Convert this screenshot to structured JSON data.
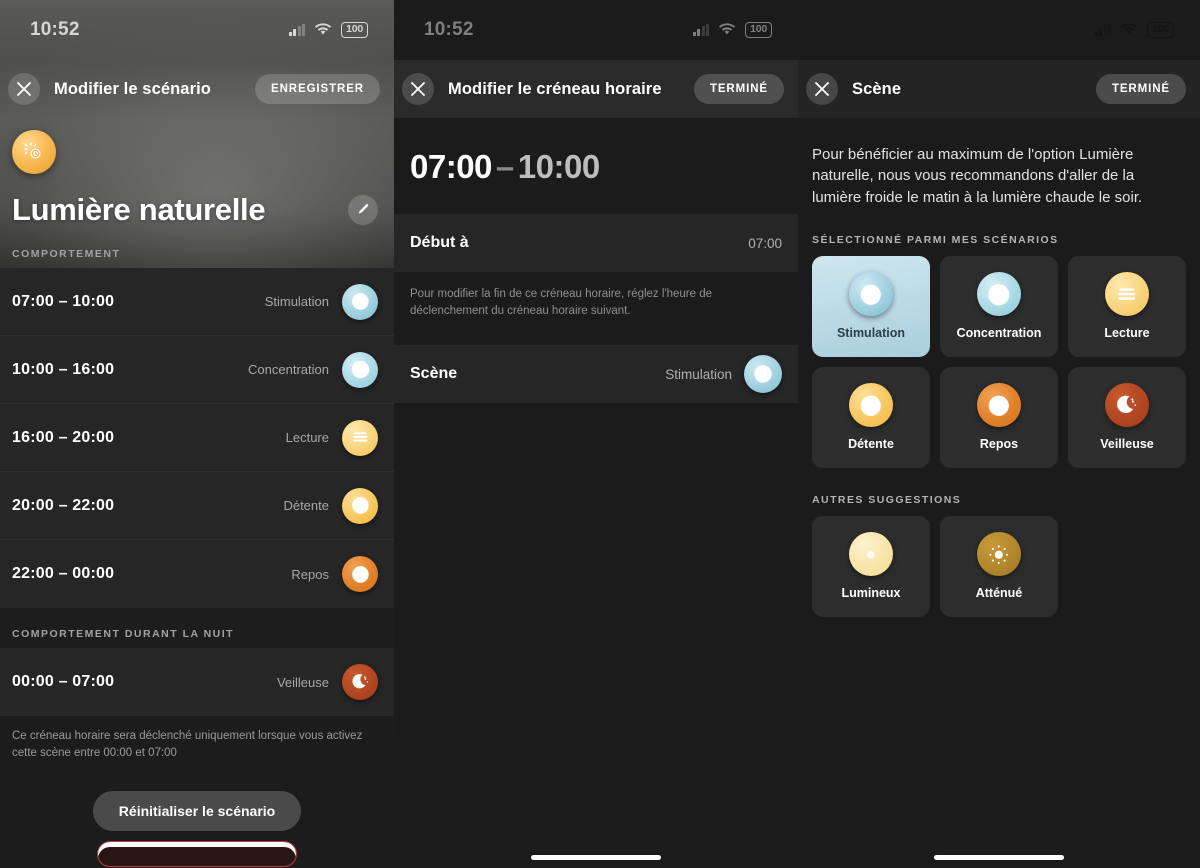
{
  "panel1": {
    "status": {
      "time": "10:52",
      "battery": "100",
      "icons": [
        "cellular-signal-icon",
        "wifi-icon",
        "battery-icon"
      ]
    },
    "nav": {
      "close_icon": "close-icon",
      "title": "Modifier le scénario",
      "action": "ENREGISTRER"
    },
    "hero": {
      "avatar_icon": "natural-light-icon",
      "title": "Lumière naturelle",
      "edit_icon": "pencil-icon"
    },
    "behavior_label": "COMPORTEMENT",
    "slots": [
      {
        "time": "07:00 – 10:00",
        "scene": "Stimulation",
        "icon": "stimulation-icon"
      },
      {
        "time": "10:00 – 16:00",
        "scene": "Concentration",
        "icon": "concentration-icon"
      },
      {
        "time": "16:00 – 20:00",
        "scene": "Lecture",
        "icon": "lecture-icon"
      },
      {
        "time": "20:00 – 22:00",
        "scene": "Détente",
        "icon": "detente-icon"
      },
      {
        "time": "22:00 – 00:00",
        "scene": "Repos",
        "icon": "repos-icon"
      }
    ],
    "night_label": "COMPORTEMENT DURANT LA NUIT",
    "night_slot": {
      "time": "00:00 – 07:00",
      "scene": "Veilleuse",
      "icon": "veilleuse-icon"
    },
    "footnote": "Ce créneau horaire sera déclenché uniquement lorsque vous activez cette scène entre 00:00 et 07:00",
    "reset_button": "Réinitialiser le scénario",
    "delete_button": ""
  },
  "panel2": {
    "status": {
      "time": "10:52",
      "battery": "100"
    },
    "nav": {
      "close_icon": "close-icon",
      "title": "Modifier le créneau horaire",
      "action": "TERMINÉ"
    },
    "range": {
      "start": "07:00",
      "dash": "–",
      "end": "10:00"
    },
    "start_row": {
      "label": "Début à",
      "value": "07:00"
    },
    "help": "Pour modifier la fin de ce créneau horaire, réglez l'heure de déclenchement du créneau horaire suivant.",
    "scene_row": {
      "label": "Scène",
      "value": "Stimulation",
      "icon": "stimulation-icon"
    }
  },
  "panel3": {
    "nav": {
      "close_icon": "close-icon",
      "title": "Scène",
      "action": "TERMINÉ"
    },
    "intro": "Pour bénéficier au maximum de l'option Lumière naturelle, nous vous recommandons d'aller de la lumière froide le matin à la lumière chaude le soir.",
    "section_selected": "SÉLECTIONNÉ PARMI MES SCÉNARIOS",
    "scenes": [
      {
        "label": "Stimulation",
        "icon": "stimulation-icon",
        "selected": true
      },
      {
        "label": "Concentration",
        "icon": "concentration-icon",
        "selected": false
      },
      {
        "label": "Lecture",
        "icon": "lecture-icon",
        "selected": false
      },
      {
        "label": "Détente",
        "icon": "detente-icon",
        "selected": false
      },
      {
        "label": "Repos",
        "icon": "repos-icon",
        "selected": false
      },
      {
        "label": "Veilleuse",
        "icon": "veilleuse-icon",
        "selected": false
      }
    ],
    "section_other": "AUTRES SUGGESTIONS",
    "suggestions": [
      {
        "label": "Lumineux",
        "icon": "lumineux-icon"
      },
      {
        "label": "Atténué",
        "icon": "attenue-icon"
      }
    ]
  },
  "colors": {
    "accent_selected": "#bcdfe9",
    "stimulation": "#9ccfdf",
    "concentration": "#a8d8e4",
    "lecture": "#f8d277",
    "detente": "#f6c65c",
    "repos": "#e07f2a",
    "veilleuse": "#b04521",
    "lumineux": "#f7e3a5",
    "attenue": "#b0862c",
    "delete_border": "#b84040"
  }
}
